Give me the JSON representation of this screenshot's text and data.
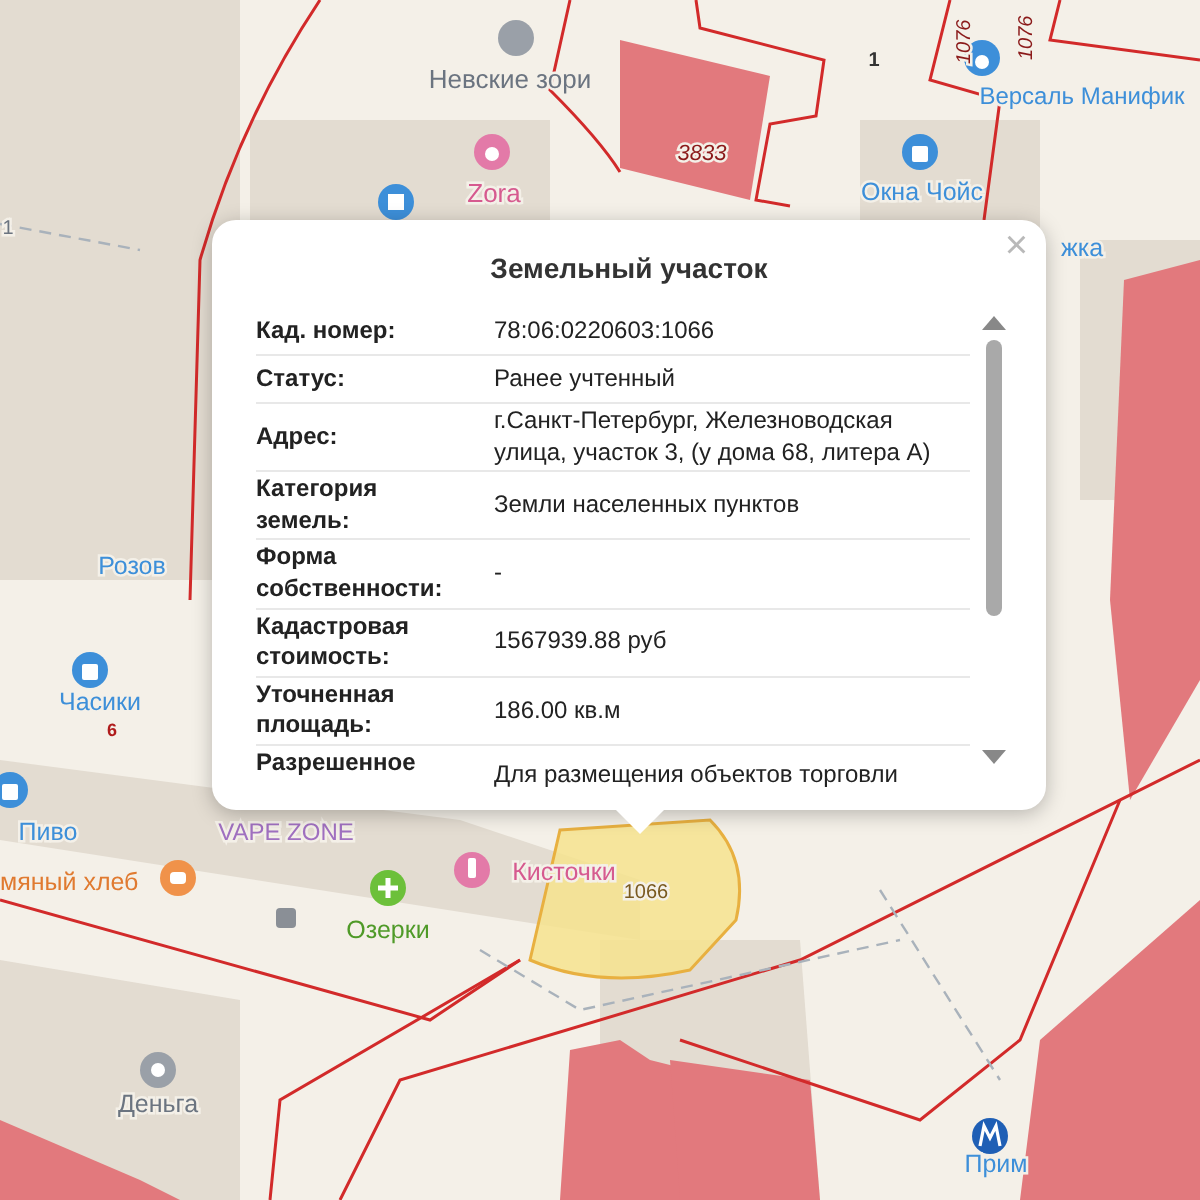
{
  "map": {
    "labels": [
      {
        "text": "Невские зори",
        "color": "#6b7480"
      },
      {
        "text": "Zora",
        "color": "#d65a8f"
      },
      {
        "text": "3833",
        "color": "#8b1a1a"
      },
      {
        "text": "1",
        "color": "#333333"
      },
      {
        "text": "1076",
        "color": "#8b1a1a"
      },
      {
        "text": "1076",
        "color": "#8b1a1a"
      },
      {
        "text": "Версаль Манифик",
        "color": "#3d8fd9"
      },
      {
        "text": "Окна Чойс",
        "color": "#3d8fd9"
      },
      {
        "text": "жка",
        "color": "#3d8fd9"
      },
      {
        "text": "Розов",
        "color": "#3d8fd9"
      },
      {
        "text": "Часики",
        "color": "#3d8fd9"
      },
      {
        "text": "6",
        "color": "#b01c1c"
      },
      {
        "text": "Пиво",
        "color": "#3d8fd9"
      },
      {
        "text": "VAPE ZONE",
        "color": "#a070c0"
      },
      {
        "text": "мяный хлеб",
        "color": "#e07a30"
      },
      {
        "text": "Озерки",
        "color": "#4f9a28"
      },
      {
        "text": "Кисточки",
        "color": "#d65a8f"
      },
      {
        "text": "1066",
        "color": "#7a5a20"
      },
      {
        "text": "Деньга",
        "color": "#6b7480"
      },
      {
        "text": "Прим",
        "color": "#3d8fd9"
      },
      {
        "text": "1",
        "color": "#6b7480"
      }
    ]
  },
  "popup": {
    "title": "Земельный участок",
    "close": "×",
    "rows": [
      {
        "label": "Кад. номер:",
        "value": "78:06:0220603:1066"
      },
      {
        "label": "Статус:",
        "value": "Ранее учтенный"
      },
      {
        "label": "Адрес:",
        "value": "г.Санкт-Петербург, Железноводская улица, участок 3, (у дома 68, литера А)"
      },
      {
        "label": "Категория земель:",
        "value": "Земли населенных пунктов"
      },
      {
        "label": "Форма собственности:",
        "value": "-"
      },
      {
        "label": "Кадастровая стоимость:",
        "value": "1567939.88 руб"
      },
      {
        "label": "Уточненная площадь:",
        "value": "186.00 кв.м"
      },
      {
        "label": "Разрешенное",
        "value": "Для размещения объектов торговли"
      }
    ]
  }
}
